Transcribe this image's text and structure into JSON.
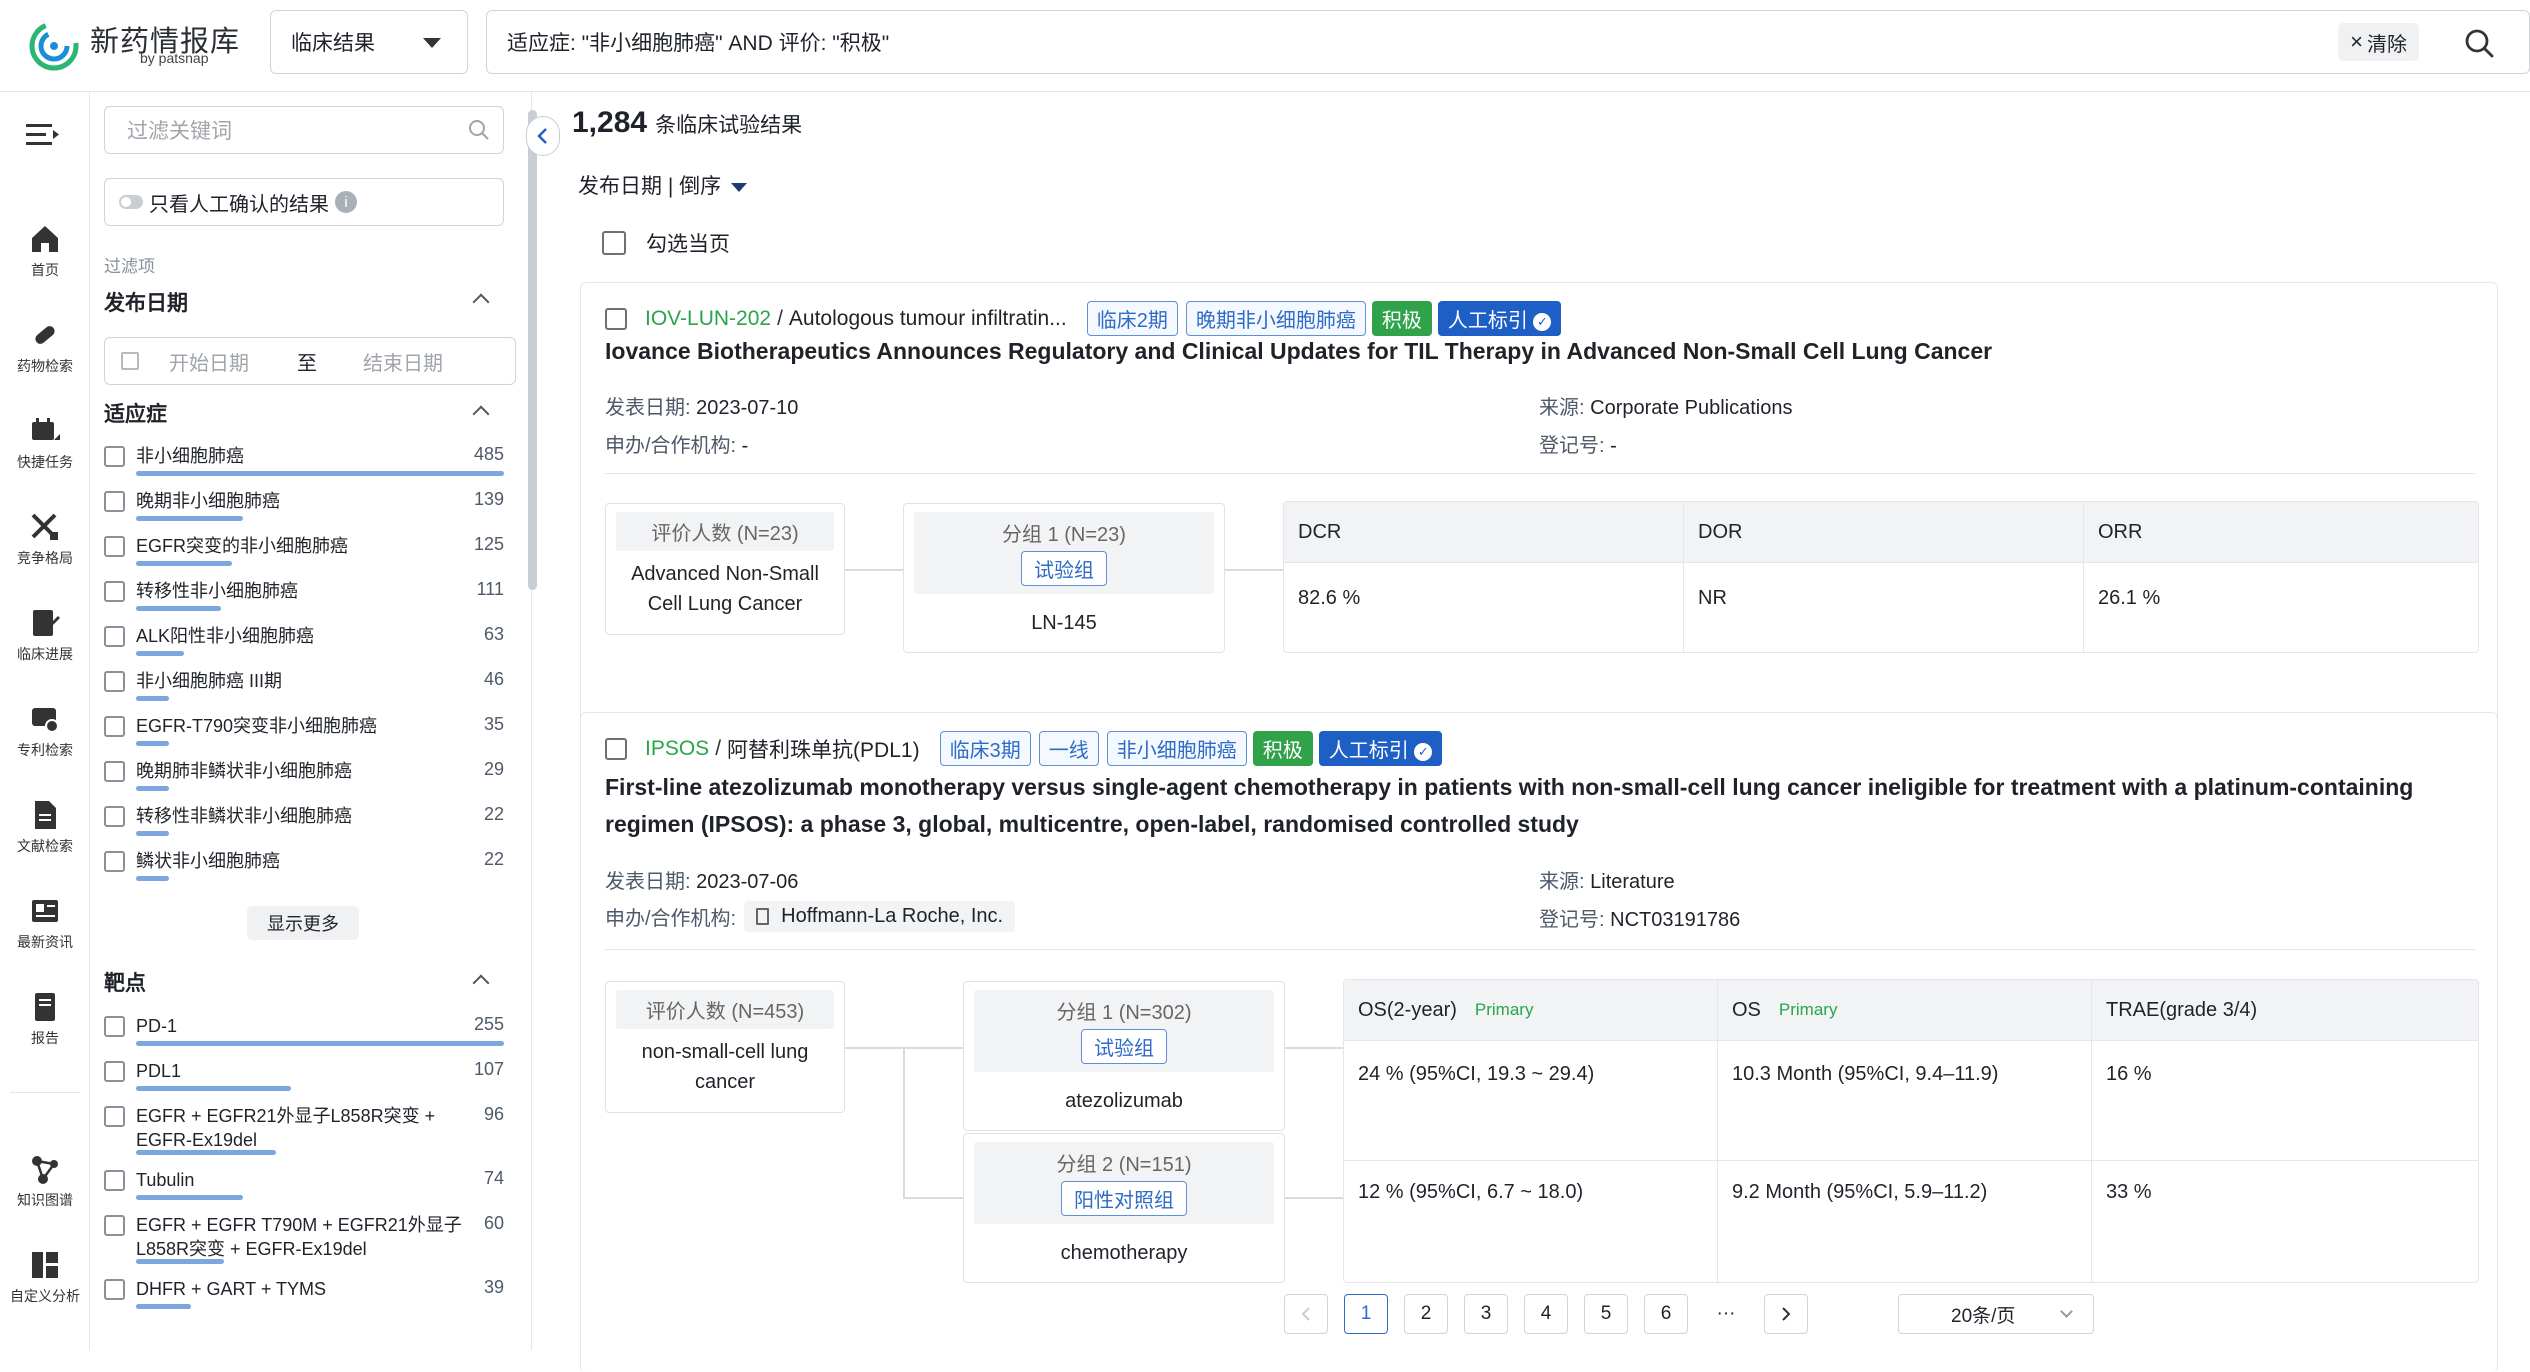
{
  "brand": {
    "name": "新药情报库",
    "by": "by patsnap"
  },
  "search": {
    "type_value": "临床结果",
    "query": "适应症: \"非小细胞肺癌\" AND 评价: \"积极\"",
    "clear_label": "清除"
  },
  "nav": [
    {
      "label": "首页",
      "icon": "home-icon"
    },
    {
      "label": "药物检索",
      "icon": "pill-icon"
    },
    {
      "label": "快捷任务",
      "icon": "task-icon"
    },
    {
      "label": "竞争格局",
      "icon": "swords-icon"
    },
    {
      "label": "临床进展",
      "icon": "clinical-icon"
    },
    {
      "label": "专利检索",
      "icon": "patent-icon"
    },
    {
      "label": "文献检索",
      "icon": "document-icon"
    },
    {
      "label": "最新资讯",
      "icon": "news-icon"
    },
    {
      "label": "报告",
      "icon": "report-icon"
    },
    {
      "label": "知识图谱",
      "icon": "graph-icon"
    },
    {
      "label": "自定义分析",
      "icon": "dashboard-icon"
    }
  ],
  "filters": {
    "keyword_placeholder": "过滤关键词",
    "manual_only": "只看人工确认的结果",
    "section_label": "过滤项",
    "date": {
      "title": "发布日期",
      "start": "开始日期",
      "to": "至",
      "end": "结束日期"
    },
    "indication": {
      "title": "适应症",
      "items": [
        {
          "label": "非小细胞肺癌",
          "count": "485",
          "frac": 1.0
        },
        {
          "label": "晚期非小细胞肺癌",
          "count": "139",
          "frac": 0.29
        },
        {
          "label": "EGFR突变的非小细胞肺癌",
          "count": "125",
          "frac": 0.26
        },
        {
          "label": "转移性非小细胞肺癌",
          "count": "111",
          "frac": 0.23
        },
        {
          "label": "ALK阳性非小细胞肺癌",
          "count": "63",
          "frac": 0.13
        },
        {
          "label": "非小细胞肺癌 III期",
          "count": "46",
          "frac": 0.09
        },
        {
          "label": "EGFR-T790突变非小细胞肺癌",
          "count": "35",
          "frac": 0.07
        },
        {
          "label": "晚期肺非鳞状非小细胞肺癌",
          "count": "29",
          "frac": 0.06
        },
        {
          "label": "转移性非鳞状非小细胞肺癌",
          "count": "22",
          "frac": 0.05
        },
        {
          "label": "鳞状非小细胞肺癌",
          "count": "22",
          "frac": 0.05
        }
      ],
      "show_more": "显示更多"
    },
    "target": {
      "title": "靶点",
      "items": [
        {
          "label": "PD-1",
          "count": "255",
          "frac": 1.0
        },
        {
          "label": "PDL1",
          "count": "107",
          "frac": 0.42
        },
        {
          "label": "EGFR + EGFR21外显子L858R突变 + EGFR-Ex19del",
          "count": "96",
          "frac": 0.38
        },
        {
          "label": "Tubulin",
          "count": "74",
          "frac": 0.29
        },
        {
          "label": "EGFR + EGFR T790M + EGFR21外显子L858R突变 + EGFR-Ex19del",
          "count": "60",
          "frac": 0.24
        },
        {
          "label": "DHFR + GART + TYMS",
          "count": "39",
          "frac": 0.15
        }
      ]
    }
  },
  "results": {
    "count": "1,284",
    "count_text": "条临床试验结果",
    "sort": "发布日期 | 倒序",
    "select_page": "勾选当页"
  },
  "cards": [
    {
      "code": "IOV-LUN-202",
      "drug": "Autologous tumour infiltratin...",
      "tags": [
        "临床2期",
        "晚期非小细胞肺癌"
      ],
      "eval_tag": "积极",
      "manual_tag": "人工标引",
      "title": "Iovance Biotherapeutics Announces Regulatory and Clinical Updates for TIL Therapy in Advanced Non-Small Cell Lung Cancer",
      "pub_date_label": "发表日期: ",
      "pub_date": "2023-07-10",
      "sponsor_label": "申办/合作机构: ",
      "sponsor": "-",
      "source_label": "来源: ",
      "source": "Corporate Publications",
      "reg_label": "登记号: ",
      "reg": "-",
      "evaluable_head": "评价人数 (N=23)",
      "evaluable_body": "Advanced Non-Small Cell Lung Cancer",
      "groups": [
        {
          "head": "分组 1 (N=23)",
          "pill": "试验组",
          "name": "LN-145"
        }
      ],
      "outcome_cols": [
        {
          "name": "DCR",
          "primary": ""
        },
        {
          "name": "DOR",
          "primary": ""
        },
        {
          "name": "ORR",
          "primary": ""
        }
      ],
      "outcome_rows": [
        [
          "82.6 %",
          "NR",
          "26.1 %"
        ]
      ]
    },
    {
      "code": "IPSOS",
      "drug": "阿替利珠单抗(PDL1)",
      "tags": [
        "临床3期",
        "一线",
        "非小细胞肺癌"
      ],
      "eval_tag": "积极",
      "manual_tag": "人工标引",
      "title": "First-line atezolizumab monotherapy versus single-agent chemotherapy in patients with non-small-cell lung cancer ineligible for treatment with a platinum-containing regimen (IPSOS): a phase 3, global, multicentre, open-label, randomised controlled study",
      "pub_date_label": "发表日期: ",
      "pub_date": "2023-07-06",
      "sponsor_label": "申办/合作机构: ",
      "sponsor": "Hoffmann-La Roche, Inc.",
      "source_label": "来源: ",
      "source": "Literature",
      "reg_label": "登记号: ",
      "reg": "NCT03191786",
      "evaluable_head": "评价人数 (N=453)",
      "evaluable_body": "non-small-cell lung cancer",
      "groups": [
        {
          "head": "分组 1 (N=302)",
          "pill": "试验组",
          "name": "atezolizumab"
        },
        {
          "head": "分组 2 (N=151)",
          "pill": "阳性对照组",
          "name": "chemotherapy"
        }
      ],
      "outcome_cols": [
        {
          "name": "OS(2-year)",
          "primary": "Primary"
        },
        {
          "name": "OS",
          "primary": "Primary"
        },
        {
          "name": "TRAE(grade 3/4)",
          "primary": ""
        }
      ],
      "outcome_rows": [
        [
          "24 % (95%CI, 19.3 ~ 29.4)",
          "10.3 Month (95%CI, 9.4–11.9)",
          "16 %"
        ],
        [
          "12 % (95%CI, 6.7 ~ 18.0)",
          "9.2 Month (95%CI, 5.9–11.2)",
          "33 %"
        ]
      ]
    }
  ],
  "pagination": {
    "pages": [
      "1",
      "2",
      "3",
      "4",
      "5",
      "6"
    ],
    "ellipsis": "···",
    "per_page": "20条/页"
  }
}
